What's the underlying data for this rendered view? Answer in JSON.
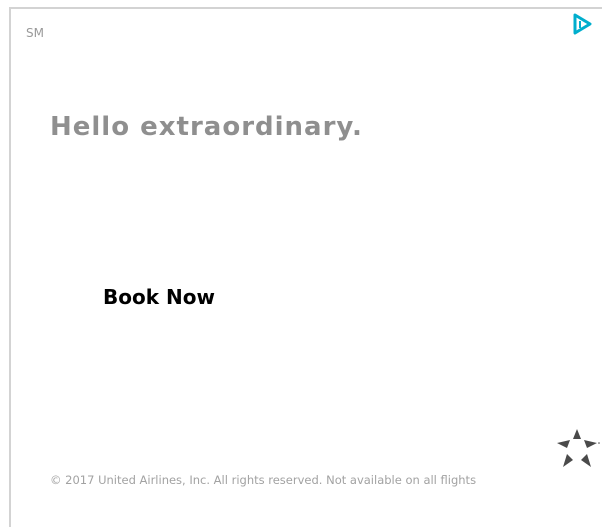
{
  "ad": {
    "badge": "SM",
    "headline": "Hello extraordinary.",
    "cta_label": "Book Now",
    "legal": "© 2017 United Airlines, Inc. All rights reserved. Not available on all flights",
    "adchoices_icon": "adchoices-icon",
    "logo_icon": "star-alliance-logo",
    "colors": {
      "headline": "#8f8f8f",
      "cta": "#000000",
      "legal": "#a2a2a2",
      "adchoices": "#00aecd",
      "border": "#d3d3d3",
      "logo": "#4a4a4a"
    }
  }
}
